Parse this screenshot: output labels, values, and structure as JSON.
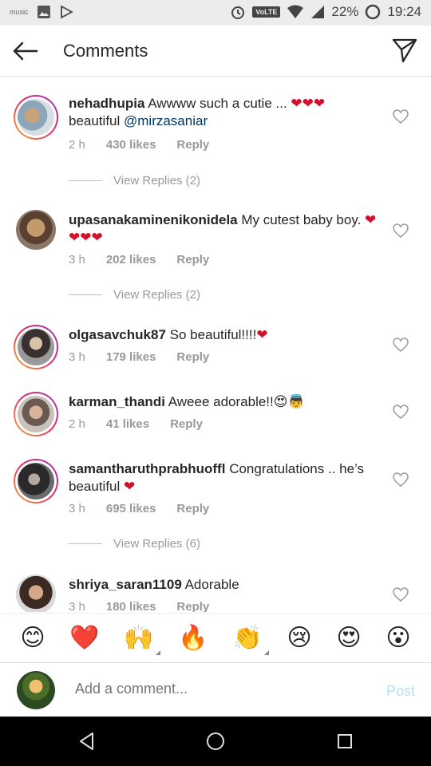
{
  "status_bar": {
    "music_label": "music",
    "volte": "VoLTE",
    "battery": "22%",
    "time": "19:24"
  },
  "header": {
    "title": "Comments"
  },
  "comments": [
    {
      "username": "nehadhupia",
      "text": "Awwww such a cutie ... ",
      "hearts": "❤❤❤",
      "text2": " beautiful ",
      "mention": "@mirzasaniar",
      "time": "2 h",
      "likes": "430 likes",
      "reply": "Reply",
      "view_replies": "View Replies (2)"
    },
    {
      "username": "upasanakaminenikonidela",
      "text": "My cutest baby boy. ",
      "hearts": "❤❤❤❤",
      "time": "3 h",
      "likes": "202 likes",
      "reply": "Reply",
      "view_replies": "View Replies (2)"
    },
    {
      "username": "olgasavchuk87",
      "text": "So beautiful!!!!",
      "hearts": "❤",
      "time": "3 h",
      "likes": "179 likes",
      "reply": "Reply"
    },
    {
      "username": "karman_thandi",
      "text": "Aweee adorable!!",
      "emojis": "😍👼",
      "time": "2 h",
      "likes": "41 likes",
      "reply": "Reply"
    },
    {
      "username": "samantharuthprabhuoffl",
      "text": "Congratulations .. he’s beautiful ",
      "hearts": "❤",
      "time": "3 h",
      "likes": "695 likes",
      "reply": "Reply",
      "view_replies": "View Replies (6)"
    },
    {
      "username": "shriya_saran1109",
      "text": "Adorable",
      "time": "3 h",
      "likes": "180 likes",
      "reply": "Reply"
    }
  ],
  "emoji_bar": [
    "😊",
    "❤️",
    "🙌",
    "🔥",
    "👏",
    "😢",
    "😍",
    "😮"
  ],
  "add_comment": {
    "placeholder": "Add a comment...",
    "post": "Post"
  },
  "colors": {
    "heart": "#d2112b",
    "mention": "#003569",
    "meta": "#999999",
    "post_disabled": "#b2dffc"
  }
}
